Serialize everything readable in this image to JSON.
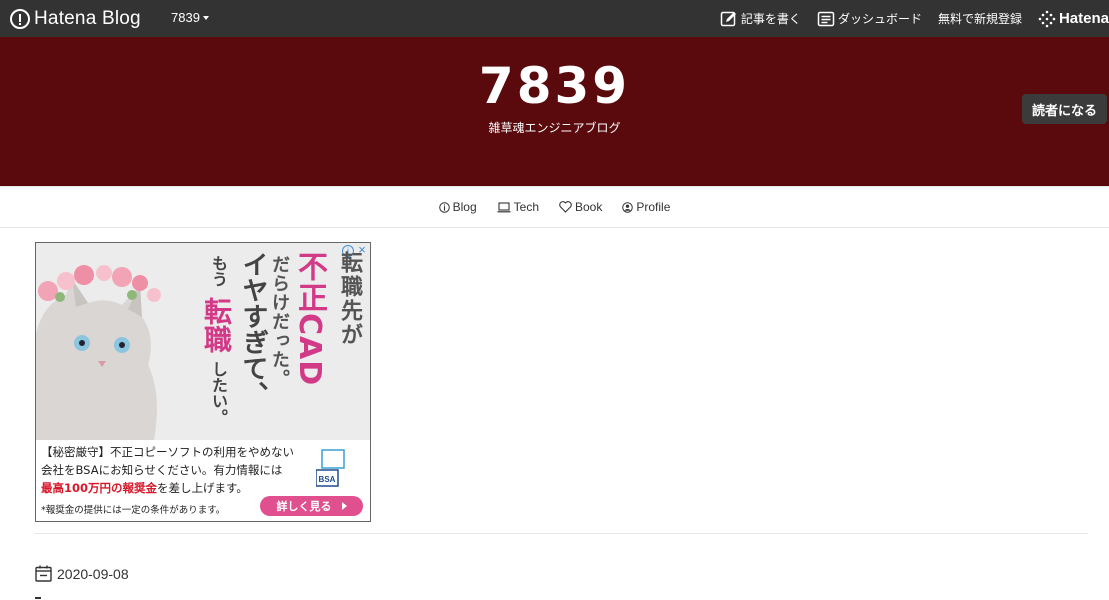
{
  "global_header": {
    "logo_text": "Hatena Blog",
    "blog_switcher": "7839",
    "write_label": "記事を書く",
    "dashboard_label": "ダッシュボード",
    "register_label": "無料で新規登録",
    "hatena_label": "Hatena"
  },
  "blog": {
    "title": "7839",
    "description": "雑草魂エンジニアブログ",
    "subscribe_label": "読者になる",
    "header_bg_color": "#5a090c"
  },
  "nav": {
    "items": [
      {
        "label": "Blog",
        "icon": "info-icon"
      },
      {
        "label": "Tech",
        "icon": "laptop-icon"
      },
      {
        "label": "Book",
        "icon": "heart-icon"
      },
      {
        "label": "Profile",
        "icon": "user-circle-icon"
      }
    ]
  },
  "ad": {
    "copy_1": "転職先が",
    "copy_2": "不正CAD",
    "copy_3": "だらけだった。",
    "copy_4": "イヤすぎて、",
    "copy_5": "もう",
    "copy_6": "転職",
    "copy_7": "したい。",
    "line_1": "【秘密厳守】不正コピーソフトの利用をやめない",
    "line_2": "会社をBSAにお知らせください。有力情報には",
    "prize": "最高100万円の報奨金",
    "line_3_suffix": "を差し上げます。",
    "note": "*報奨金の提供には一定の条件があります。",
    "cta_label": "詳しく見る",
    "bsa_label": "BSA",
    "accent_color": "#e0508f"
  },
  "entry": {
    "date": "2020-09-08"
  }
}
